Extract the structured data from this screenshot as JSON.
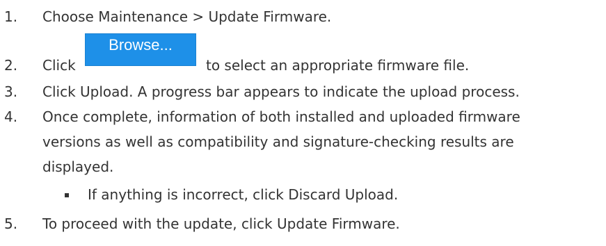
{
  "steps": [
    {
      "number": "1.",
      "text": "Choose Maintenance > Update Firmware."
    },
    {
      "number": "2.",
      "prefix": "Click",
      "button_label": "Browse...",
      "text": "to select an appropriate firmware file."
    },
    {
      "number": "3.",
      "text": "Click Upload. A progress bar appears to indicate the upload process."
    },
    {
      "number": "4.",
      "lines": [
        "Once complete, information of both installed and uploaded firmware",
        "versions as well as compatibility and signature-checking results are",
        "displayed."
      ],
      "sub_bullet": "If anything is incorrect, click Discard Upload."
    },
    {
      "number": "5.",
      "text": "To proceed with the update, click Update Firmware."
    }
  ],
  "colors": {
    "text": "#333333",
    "button_bg": "#1e90e8",
    "button_text": "#ffffff"
  }
}
